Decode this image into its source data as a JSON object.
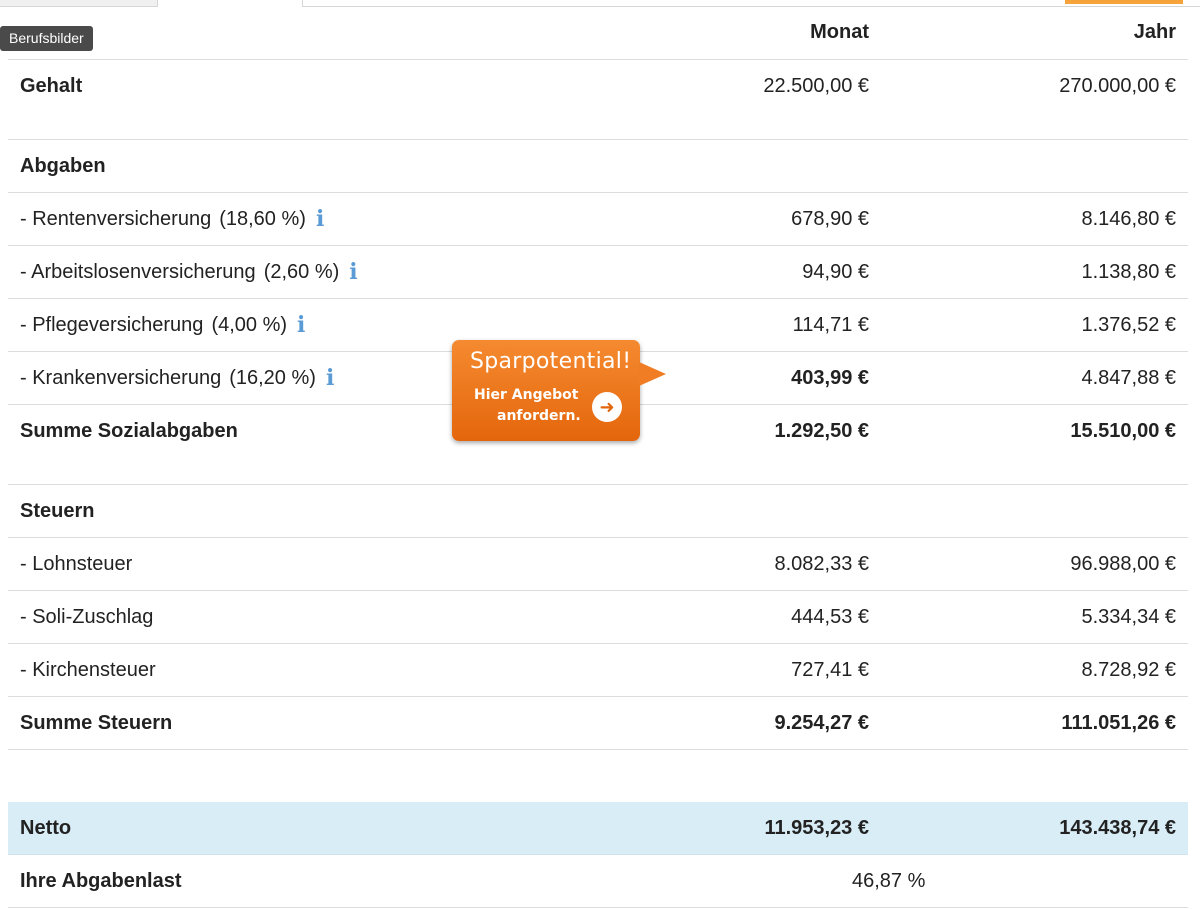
{
  "tooltip": "Berufsbilder",
  "columns": {
    "monat": "Monat",
    "jahr": "Jahr"
  },
  "gehalt": {
    "label": "Gehalt",
    "monat": "22.500,00 €",
    "jahr": "270.000,00 €"
  },
  "abgaben": {
    "heading": "Abgaben",
    "items": [
      {
        "label": "- Rentenversicherung",
        "pct": "(18,60 %)",
        "monat": "678,90 €",
        "jahr": "8.146,80 €"
      },
      {
        "label": "- Arbeitslosenversicherung",
        "pct": "(2,60 %)",
        "monat": "94,90 €",
        "jahr": "1.138,80 €"
      },
      {
        "label": "- Pflegeversicherung",
        "pct": "(4,00 %)",
        "monat": "114,71 €",
        "jahr": "1.376,52 €"
      },
      {
        "label": "- Krankenversicherung",
        "pct": "(16,20 %)",
        "monat": "403,99 €",
        "jahr": "4.847,88 €"
      }
    ],
    "summe": {
      "label": "Summe Sozialabgaben",
      "monat": "1.292,50 €",
      "jahr": "15.510,00 €"
    }
  },
  "steuern": {
    "heading": "Steuern",
    "items": [
      {
        "label": "- Lohnsteuer",
        "monat": "8.082,33 €",
        "jahr": "96.988,00 €"
      },
      {
        "label": "- Soli-Zuschlag",
        "monat": "444,53 €",
        "jahr": "5.334,34 €"
      },
      {
        "label": "- Kirchensteuer",
        "monat": "727,41 €",
        "jahr": "8.728,92 €"
      }
    ],
    "summe": {
      "label": "Summe Steuern",
      "monat": "9.254,27 €",
      "jahr": "111.051,26 €"
    }
  },
  "netto": {
    "label": "Netto",
    "monat": "11.953,23 €",
    "jahr": "143.438,74 €"
  },
  "abgabenlast": {
    "label": "Ihre Abgabenlast",
    "value": "46,87 %"
  },
  "promo": {
    "title": "Sparpotential!",
    "line1": "Hier Angebot",
    "line2": "anfordern."
  },
  "icons": {
    "info": "info-icon",
    "arrow": "arrow-right-icon"
  },
  "colors": {
    "accent_orange": "#e4660c",
    "netto_bg": "#d9edf7",
    "info_blue": "#5b9bd5"
  }
}
